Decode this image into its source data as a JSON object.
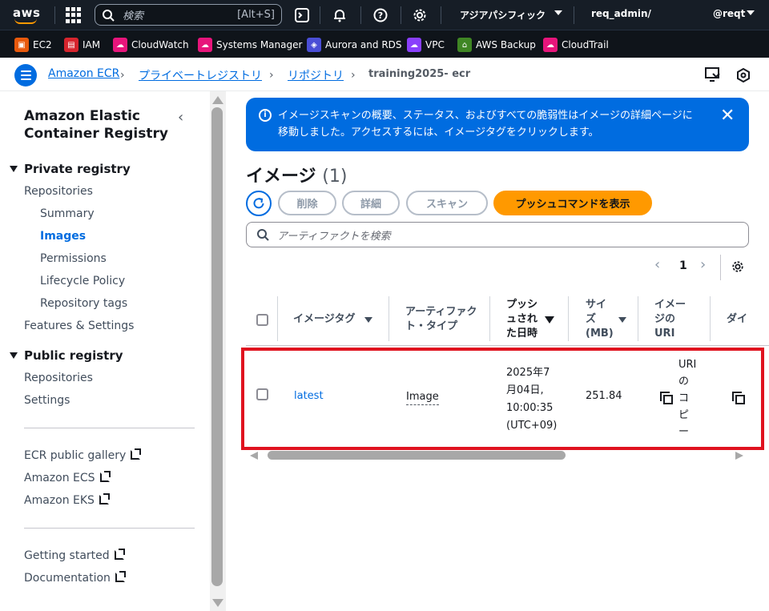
{
  "topnav": {
    "logo": "aws",
    "search_placeholder": "検索",
    "search_shortcut": "[Alt+S]",
    "region": "アジアパシフィック",
    "account": "req_admin/",
    "user": "@reqt"
  },
  "favorites": [
    {
      "label": "EC2",
      "color": "#e8590c"
    },
    {
      "label": "IAM",
      "color": "#d6242d"
    },
    {
      "label": "CloudWatch",
      "color": "#e7157b"
    },
    {
      "label": "Systems Manager",
      "color": "#e7157b"
    },
    {
      "label": "Aurora and RDS",
      "color": "#4a4ed6"
    },
    {
      "label": "VPC",
      "color": "#8a3ffc"
    },
    {
      "label": "AWS Backup",
      "color": "#3f8624"
    },
    {
      "label": "CloudTrail",
      "color": "#e7157b"
    }
  ],
  "breadcrumb": {
    "items": [
      "Amazon ECR",
      "プライベートレジストリ",
      "リポジトリ"
    ],
    "current": "training2025-      ecr"
  },
  "sidebar": {
    "title": "Amazon Elastic Container Registry",
    "private_heading": "Private registry",
    "private_items": [
      "Repositories",
      "Summary",
      "Images",
      "Permissions",
      "Lifecycle Policy",
      "Repository tags"
    ],
    "features": "Features & Settings",
    "public_heading": "Public registry",
    "public_items": [
      "Repositories",
      "Settings"
    ],
    "external_links": [
      "ECR public gallery",
      "Amazon ECS",
      "Amazon EKS"
    ],
    "help_links": [
      "Getting started",
      "Documentation"
    ]
  },
  "flash": {
    "message": "イメージスキャンの概要、ステータス、およびすべての脆弱性はイメージの詳細ページに移動しました。アクセスするには、イメージタグをクリックします。",
    "color": "#006ce0"
  },
  "page": {
    "title": "イメージ",
    "count": "(1)"
  },
  "actions": {
    "delete": "削除",
    "details": "詳細",
    "scan": "スキャン",
    "push_commands": "プッシュコマンドを表示"
  },
  "filter": {
    "placeholder": "アーティファクトを検索"
  },
  "pagination": {
    "current_page": "1"
  },
  "table": {
    "headers": {
      "tag": "イメージタグ",
      "artifact_type": "アーティファクト・タイプ",
      "pushed_at": "プッシュされた日時",
      "size": "サイズ (MB)",
      "uri": "イメージのURI",
      "digest": "ダイ"
    },
    "rows": [
      {
        "tag": "latest",
        "artifact_type": "Image",
        "pushed_at": "2025年7月04日, 10:00:35 (UTC+09)",
        "size": "251.84",
        "uri_copy": "URIのコピー"
      }
    ]
  }
}
